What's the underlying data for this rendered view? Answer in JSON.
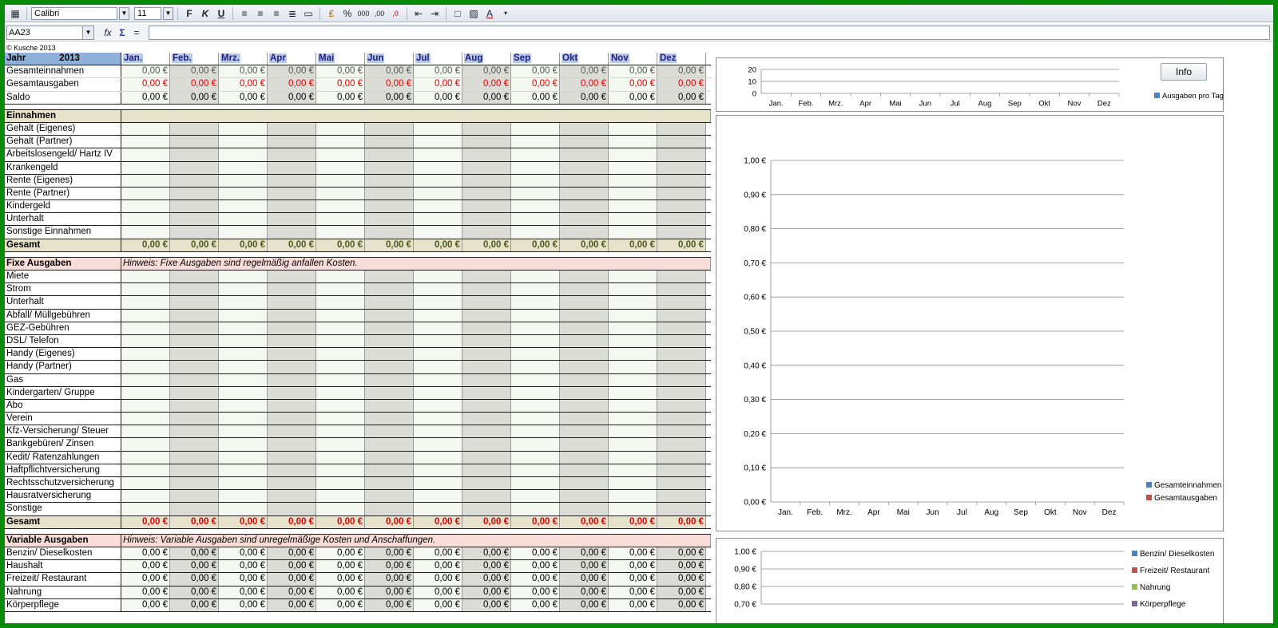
{
  "toolbar": {
    "font_name": "Calibri",
    "font_size": "11",
    "bold": "F",
    "italic": "K",
    "underline": "U"
  },
  "formula_bar": {
    "name_box": "AA23",
    "fx": "fx",
    "sum": "Σ",
    "equals": "=",
    "formula": ""
  },
  "sheet": {
    "copyright": "© Kusche 2013",
    "year_label": "Jahr",
    "year": "2013",
    "months": [
      "Jan.",
      "Feb.",
      "Mrz.",
      "Apr",
      "Mai",
      "Jun",
      "Jul",
      "Aug",
      "Sep",
      "Okt",
      "Nov",
      "Dez"
    ],
    "zero": "0,00 €",
    "summary_rows": [
      "Gesamteinnahmen",
      "Gesamtausgaben",
      "Saldo"
    ],
    "income_title": "Einnahmen",
    "income_rows": [
      "Gehalt (Eigenes)",
      "Gehalt  (Partner)",
      "Arbeitslosengeld/ Hartz IV",
      "Krankengeld",
      "Rente (Eigenes)",
      "Rente (Partner)",
      "Kindergeld",
      "Unterhalt",
      "Sonstige Einnahmen"
    ],
    "total_label": "Gesamt",
    "fixed_title": "Fixe Ausgaben",
    "fixed_hint": "Hinweis: Fixe Ausgaben sind regelmäßig anfallen Kosten.",
    "fixed_rows": [
      "Miete",
      "Strom",
      "Unterhalt",
      "Abfall/ Müllgebühren",
      "GEZ-Gebühren",
      "DSL/ Telefon",
      "Handy (Eigenes)",
      "Handy (Partner)",
      "Gas",
      "Kindergarten/ Gruppe",
      "Abo",
      "Verein",
      "Kfz-Versicherung/ Steuer",
      "Bankgebüren/ Zinsen",
      "Kedit/ Ratenzahlungen",
      "Haftpflichtversicherung",
      "Rechtsschutzversicherung",
      "Hausratversicherung",
      "Sonstige"
    ],
    "variable_title": "Variable Ausgaben",
    "variable_hint": "Hinweis: Variable Ausgaben sind unregelmäßige Kosten und Anschaffungen.",
    "variable_rows": [
      "Benzin/ Dieselkosten",
      "Haushalt",
      "Freizeit/ Restaurant",
      "Nahrung",
      "Körperpflege"
    ]
  },
  "info_button": "Info",
  "chart_data": [
    {
      "type": "bar",
      "categories": [
        "Jan.",
        "Feb.",
        "Mrz.",
        "Apr",
        "Mai",
        "Jun",
        "Jul",
        "Aug",
        "Sep",
        "Okt",
        "Nov",
        "Dez"
      ],
      "series": [
        {
          "name": "Ausgaben pro Tag",
          "values": [
            0,
            0,
            0,
            0,
            0,
            0,
            0,
            0,
            0,
            0,
            0,
            0
          ]
        }
      ],
      "yticks": [
        "0",
        "10",
        "20"
      ],
      "ylim": [
        0,
        20
      ],
      "legend_position": "right",
      "colors": [
        "#4f81bd"
      ]
    },
    {
      "type": "bar",
      "categories": [
        "Jan.",
        "Feb.",
        "Mrz.",
        "Apr",
        "Mai",
        "Jun",
        "Jul",
        "Aug",
        "Sep",
        "Okt",
        "Nov",
        "Dez"
      ],
      "series": [
        {
          "name": "Gesamteinnahmen",
          "values": [
            0,
            0,
            0,
            0,
            0,
            0,
            0,
            0,
            0,
            0,
            0,
            0
          ]
        },
        {
          "name": "Gesamtausgaben",
          "values": [
            0,
            0,
            0,
            0,
            0,
            0,
            0,
            0,
            0,
            0,
            0,
            0
          ]
        }
      ],
      "yticks": [
        "0,00 €",
        "0,10 €",
        "0,20 €",
        "0,30 €",
        "0,40 €",
        "0,50 €",
        "0,60 €",
        "0,70 €",
        "0,80 €",
        "0,90 €",
        "1,00 €"
      ],
      "ylim": [
        0,
        1
      ],
      "legend_position": "bottom-right",
      "colors": [
        "#4f81bd",
        "#c0504d"
      ]
    },
    {
      "type": "bar",
      "series": [
        {
          "name": "Benzin/ Dieselkosten"
        },
        {
          "name": "Freizeit/ Restaurant"
        },
        {
          "name": "Nahrung"
        },
        {
          "name": "Körperpflege"
        }
      ],
      "yticks": [
        "0,70 €",
        "0,80 €",
        "0,90 €",
        "1,00 €"
      ],
      "ylim": [
        0.7,
        1
      ],
      "legend_position": "top-right",
      "colors": [
        "#4f81bd",
        "#c0504d",
        "#9bbb59",
        "#8064a2"
      ]
    }
  ]
}
